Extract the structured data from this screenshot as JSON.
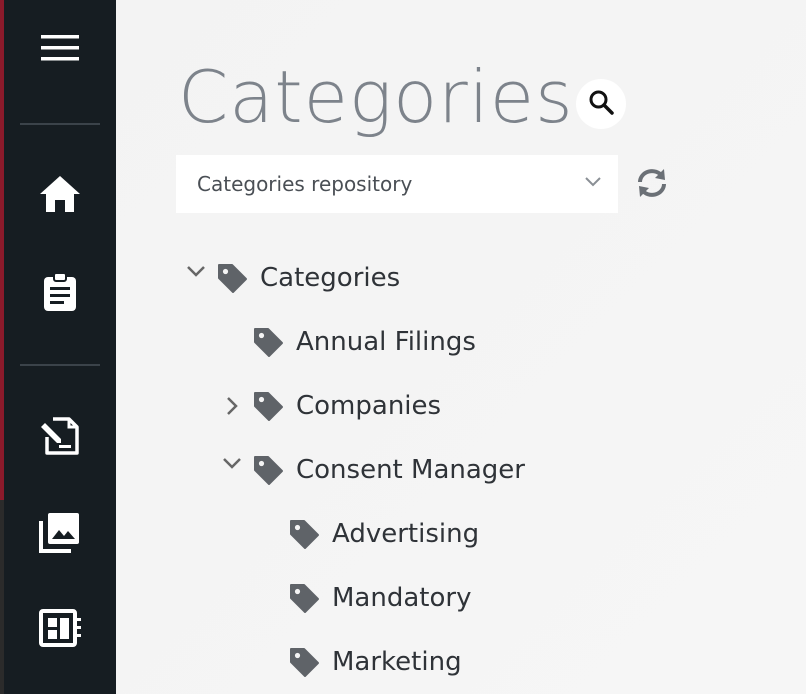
{
  "header": {
    "title": "Categories"
  },
  "repository_select": {
    "selected": "Categories repository"
  },
  "sidebar": {
    "items": [
      {
        "icon": "menu-icon"
      },
      {
        "icon": "home-icon"
      },
      {
        "icon": "clipboard-icon"
      },
      {
        "icon": "document-edit-icon"
      },
      {
        "icon": "media-gallery-icon"
      },
      {
        "icon": "dashboard-icon"
      }
    ]
  },
  "tree": {
    "root": {
      "label": "Categories",
      "expanded": true
    },
    "items": [
      {
        "label": "Annual Filings",
        "level": 1,
        "toggle": "none"
      },
      {
        "label": "Companies",
        "level": 1,
        "toggle": "collapsed"
      },
      {
        "label": "Consent Manager",
        "level": 1,
        "toggle": "expanded"
      },
      {
        "label": "Advertising",
        "level": 2,
        "toggle": "none"
      },
      {
        "label": "Mandatory",
        "level": 2,
        "toggle": "none"
      },
      {
        "label": "Marketing",
        "level": 2,
        "toggle": "none"
      }
    ]
  },
  "colors": {
    "sidebar_bg": "#161d22",
    "content_bg": "#f4f4f4",
    "title_text": "#7d838b",
    "tag_icon": "#5f6368",
    "accent_edge": "#8b1a2b"
  }
}
